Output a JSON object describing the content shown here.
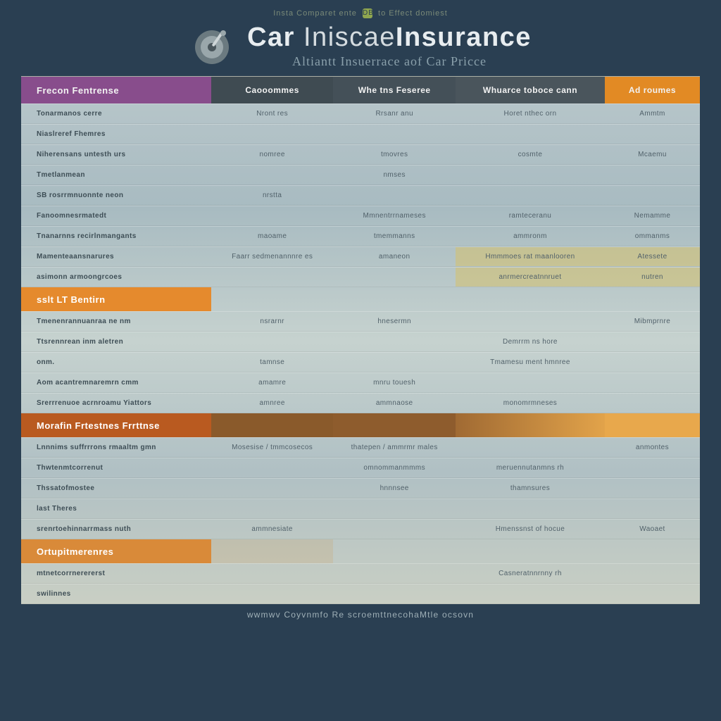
{
  "tagline": {
    "left": "Insta Comparet ente",
    "badge": "DB",
    "right": "to Effect domiest"
  },
  "header": {
    "title_a": "Car",
    "title_b": "Iniscae",
    "title_c": "Insurance",
    "subtitle": "Altiantt Insuerrace aof Car Pricce"
  },
  "columns": {
    "feature": "Frecon Fentrense",
    "plan1": "Caooommes",
    "plan2": "Whe tns Feseree",
    "plan3": "Whuarce toboce cann",
    "plan4": "Ad roumes"
  },
  "sections": [
    {
      "band": null,
      "rows": [
        {
          "name": "Tonarmanos cerre",
          "c1": "Nront res",
          "c2": "Rrsanr anu",
          "c3": "Horet nthec orn",
          "c4": "Ammtm"
        },
        {
          "name": "Niaslreref Fhemres",
          "c1": "",
          "c2": "",
          "c3": "",
          "c4": ""
        },
        {
          "name": "Niherensans untesth urs",
          "c1": "nomree",
          "c2": "tmovres",
          "c3": "cosmte",
          "c4": "Mcaemu"
        },
        {
          "name": "Tmetlanmean",
          "c1": "",
          "c2": "nmses",
          "c3": "",
          "c4": ""
        },
        {
          "name": "SB rosrrmnuonnte neon",
          "c1": "nrstta",
          "c2": "",
          "c3": "",
          "c4": ""
        },
        {
          "name": "Fanoomnesrmatedt",
          "c1": "",
          "c2": "Mmnentrrnameses",
          "c3": "ramteceranu",
          "c4": "Nemamme"
        },
        {
          "name": "Tnanarnns recirlnmangants",
          "c1": "maoame",
          "c2": "tmemmanns",
          "c3": "ammronm",
          "c4": "ommanms"
        },
        {
          "name": "Mamenteaansnarures",
          "c1": "Faarr sedmenannnre es",
          "c2": "amaneon",
          "c3": "Hmmmoes rat maanlooren",
          "c4": "Atessete",
          "hl": true
        },
        {
          "name": "asimonn  armoongrcoes",
          "c1": "",
          "c2": "",
          "c3": "anrmercreatnnruet",
          "c4": "nutren",
          "hl": true
        }
      ]
    },
    {
      "band": "sslt LT Bentirn",
      "rows": [
        {
          "name": "Tmenenrannuanraa ne nm",
          "c1": "nsrarnr",
          "c2": "hnesermn",
          "c3": "",
          "c4": "Mibmprnre"
        },
        {
          "name": "Ttsrennrean inm aletren",
          "c1": "",
          "c2": "",
          "c3": "Demrrm ns hore",
          "c4": ""
        },
        {
          "name": "onm.",
          "c1": "tamnse",
          "c2": "",
          "c3": "Tmamesu ment hmnree",
          "c4": ""
        },
        {
          "name": "Aom acantremnaremrn cmm",
          "c1": "amamre",
          "c2": "mnru touesh",
          "c3": "",
          "c4": ""
        },
        {
          "name": "Srerrrenuoe  acrnroamu Yiattors",
          "c1": "amnree",
          "c2": "ammnaose",
          "c3": "monomrmneses",
          "c4": ""
        }
      ]
    },
    {
      "band": "Morafin Frtestnes Frrttnse",
      "rows": [
        {
          "name": "Lnnnims suffrrrons rmaaltm gmn",
          "c1": "Mosesise / tmmcosecos",
          "c2": "thatepen / ammrmr males",
          "c3": "",
          "c4": "anmontes"
        },
        {
          "name": "Thwtenmtcorrenut",
          "c1": "",
          "c2": "omnommanmmms",
          "c3": "meruennutanmns rh",
          "c4": ""
        },
        {
          "name": "Thssatofmostee",
          "c1": "",
          "c2": "hnnnsee",
          "c3": "thamnsures",
          "c4": ""
        },
        {
          "name": "last Theres",
          "c1": "",
          "c2": "",
          "c3": "",
          "c4": ""
        },
        {
          "name": "srenrtoehinnarrmass nuth",
          "c1": "ammnesiate",
          "c2": "",
          "c3": "Hmenssnst of hocue",
          "c4": "Waoaet"
        }
      ]
    },
    {
      "band": "Ortupitmerenres",
      "rows": [
        {
          "name": "mtnetcorrnerererst",
          "c1": "",
          "c2": "",
          "c3": "Casneratnnrnny rh",
          "c4": ""
        },
        {
          "name": "swilinnes",
          "c1": "",
          "c2": "",
          "c3": "",
          "c4": ""
        }
      ]
    }
  ],
  "footer": "wwmwv Coyvnmfo Re scroemttnecohaMtle ocsovn"
}
